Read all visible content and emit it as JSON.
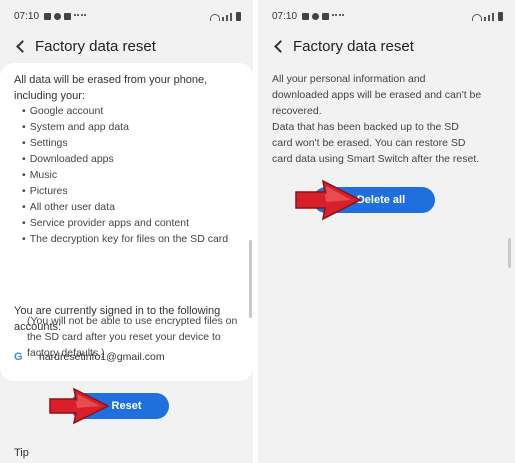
{
  "left_screen": {
    "status": {
      "time": "07:10"
    },
    "header": {
      "title": "Factory data reset"
    },
    "intro": "All data will be erased from your phone, including your:",
    "erase_items": [
      "Google account",
      "System and app data",
      "Settings",
      "Downloaded apps",
      "Music",
      "Pictures",
      "All other user data",
      "Service provider apps and content",
      "The decryption key for files on the SD card"
    ],
    "sd_note": "(You will not be able to use encrypted files on the SD card after you reset your device to factory defaults.)",
    "signed_in_text": "You are currently signed in to the following accounts:",
    "account": {
      "icon_letter": "G",
      "email": "hardresetinfo1@gmail.com"
    },
    "reset_label": "Reset",
    "tip_label": "Tip"
  },
  "right_screen": {
    "status": {
      "time": "07:10"
    },
    "header": {
      "title": "Factory data reset"
    },
    "para1": "All your personal information and downloaded apps will be erased and can't be recovered.",
    "para2": "Data that has been backed up to the SD card won't be erased. You can restore SD card data using Smart Switch after the reset.",
    "delete_label": "Delete all"
  },
  "icons": {
    "back": "chevron-left-icon",
    "google": "google-icon",
    "pointer": "red-arrow-icon"
  },
  "colors": {
    "button_blue": "#1f6fde",
    "arrow_red": "#d9202a",
    "screen_bg": "#f2f2f2",
    "card_bg": "#ffffff"
  }
}
